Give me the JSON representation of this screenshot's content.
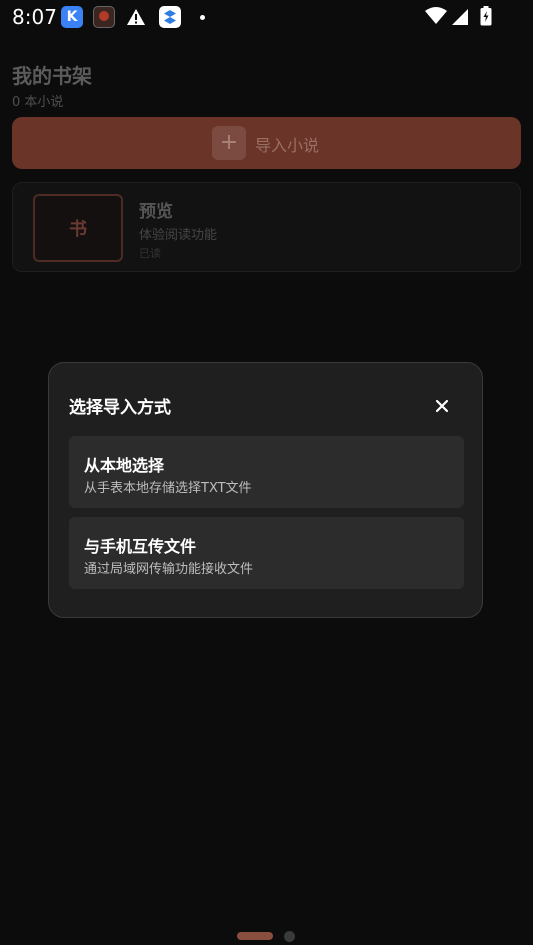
{
  "status_bar": {
    "time": "8:07",
    "notification_icons": [
      "k-app-icon",
      "photo-app-icon",
      "warning-icon",
      "box-app-icon",
      "more-dot-icon"
    ],
    "system_icons": [
      "wifi-icon",
      "signal-icon",
      "battery-charging-icon"
    ],
    "k_icon_letter": "K"
  },
  "shelf": {
    "title": "我的书架",
    "count": "0 本小说"
  },
  "import_button": {
    "icon": "+",
    "label": "导入小说"
  },
  "book": {
    "cover_char": "书",
    "name": "预览",
    "description": "体验阅读功能",
    "status": "已读"
  },
  "dialog": {
    "title": "选择导入方式",
    "close_icon": "×",
    "options": [
      {
        "title": "从本地选择",
        "subtitle": "从手表本地存储选择TXT文件"
      },
      {
        "title": "与手机互传文件",
        "subtitle": "通过局域网传输功能接收文件"
      }
    ]
  },
  "page_indicator": {
    "count": 2,
    "active_index": 0
  },
  "colors": {
    "accent": "#b3654f",
    "background": "#0c0c0c",
    "dialog_bg": "#1f1f1f",
    "option_bg": "#2c2c2c"
  }
}
